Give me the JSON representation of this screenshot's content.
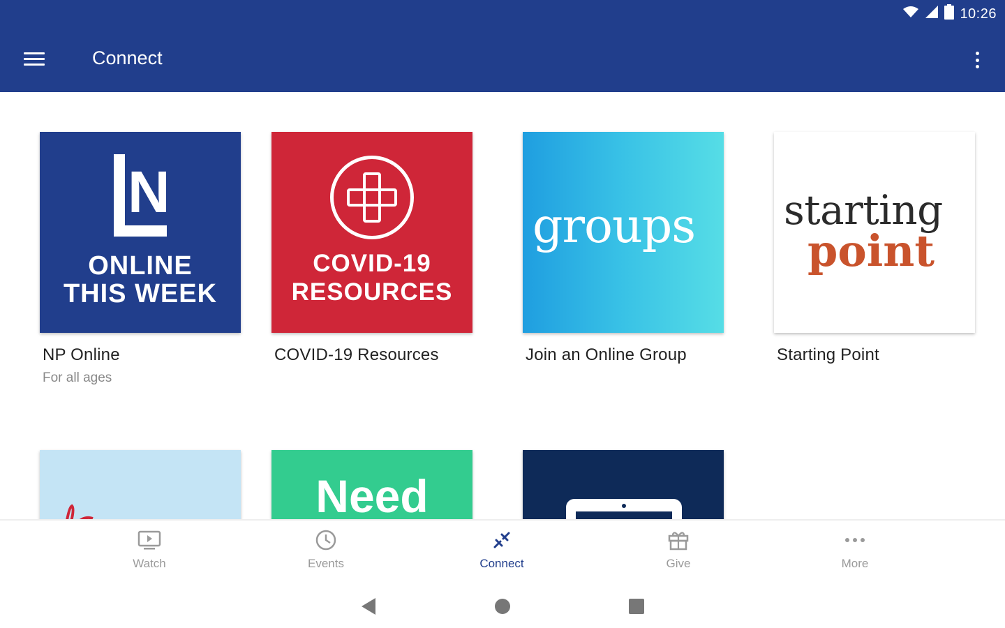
{
  "status_bar": {
    "time": "10:26",
    "icons": [
      "wifi-icon",
      "cell-signal-icon",
      "battery-icon"
    ]
  },
  "app_bar": {
    "title": "Connect",
    "menu_icon": "hamburger-menu-icon",
    "overflow_icon": "more-vert-icon"
  },
  "cards": [
    {
      "title": "NP Online",
      "subtitle": "For all ages",
      "thumb_logo": "N",
      "thumb_text_1": "ONLINE",
      "thumb_text_2": "THIS WEEK"
    },
    {
      "title": "COVID-19 Resources",
      "thumb_text_1": "COVID-19",
      "thumb_text_2": "RESOURCES"
    },
    {
      "title": "Join an Online Group",
      "thumb_text_1": "groups"
    },
    {
      "title": "Starting Point",
      "thumb_text_1": "starting",
      "thumb_text_2": "point"
    }
  ],
  "row2": [
    {
      "thumb_text_1": ""
    },
    {
      "thumb_text_1": "Need"
    },
    {
      "thumb_text_1": ""
    }
  ],
  "bottom_nav": [
    {
      "label": "Watch",
      "icon": "tv-play-icon",
      "active": false
    },
    {
      "label": "Events",
      "icon": "clock-icon",
      "active": false
    },
    {
      "label": "Connect",
      "icon": "connect-icon",
      "active": true
    },
    {
      "label": "Give",
      "icon": "gift-icon",
      "active": false
    },
    {
      "label": "More",
      "icon": "more-horiz-icon",
      "active": false
    }
  ],
  "colors": {
    "primary": "#213e8c",
    "covid_red": "#cf2638",
    "groups_blue": "#39c2e6",
    "starting_point_orange": "#c9532c",
    "need_green": "#33cc8f",
    "inactive_gray": "#9a9a9a"
  }
}
